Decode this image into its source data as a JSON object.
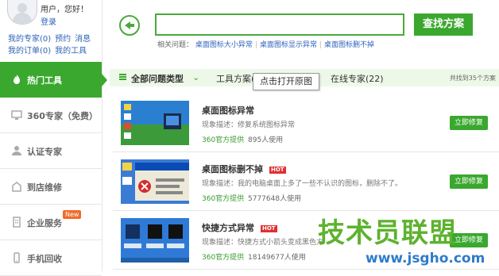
{
  "user": {
    "greeting": "用户，您好！",
    "login": "登录",
    "links_row1": [
      "我的专家(0)",
      "预约",
      "消息"
    ],
    "links_row2": [
      "我的订单(0)",
      "我的工具"
    ]
  },
  "sidebar": {
    "items": [
      {
        "label": "热门工具",
        "icon": "fire-icon",
        "active": true
      },
      {
        "label": "360专家（免费）",
        "icon": "monitor-icon"
      },
      {
        "label": "认证专家",
        "icon": "person-icon"
      },
      {
        "label": "到店维修",
        "icon": "store-icon"
      },
      {
        "label": "企业服务",
        "icon": "building-icon",
        "badge": "New"
      },
      {
        "label": "手机回收",
        "icon": "phone-icon"
      }
    ]
  },
  "search": {
    "value": "",
    "button_label": "查找方案",
    "related_label": "相关问题：",
    "related_links": [
      "桌面图标大小异常",
      "桌面图标显示异常",
      "桌面图标删不掉"
    ]
  },
  "filter": {
    "all_types": "全部问题类型",
    "tools": "工具方案(3",
    "obscured": "...",
    "experts": "在线专家(22)",
    "total": "共找到35个方案"
  },
  "tooltip": "点击打开原图",
  "results": [
    {
      "title": "桌面图标异常",
      "hot": false,
      "desc": "现象描述：修复系统图标异常",
      "provider": "360官方提供",
      "usage": "895人使用",
      "button": "立即修复"
    },
    {
      "title": "桌面图标删不掉",
      "hot": true,
      "hot_label": "HOT",
      "desc": "现象描述：我的电脑桌面上多了一些不认识的图标，删除不了。",
      "provider": "360官方提供",
      "usage": "5777648人使用",
      "button": "立即修复"
    },
    {
      "title": "快捷方式异常",
      "hot": true,
      "hot_label": "HOT",
      "desc": "现象描述：快捷方式小箭头变成黑色方",
      "provider": "360官方提供",
      "usage": "18149677人使用",
      "button": "立即修复"
    }
  ],
  "watermark": {
    "title": "技术员联盟",
    "url": "www.jsgho.com"
  },
  "colors": {
    "primary_green": "#3aa82e",
    "link_blue": "#2e64b8",
    "hot_red": "#e03030",
    "new_orange": "#f06a2b"
  }
}
